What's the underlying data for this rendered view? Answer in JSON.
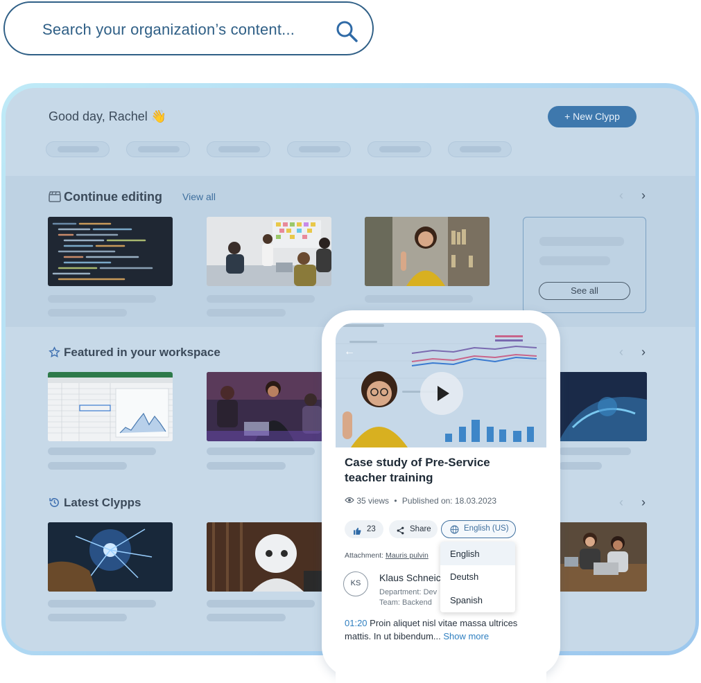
{
  "search": {
    "placeholder": "Search your organization’s content..."
  },
  "header": {
    "greeting": "Good day, Rachel",
    "greeting_emoji": "👋",
    "new_button": "+ New Clypp"
  },
  "sections": {
    "continue_editing": {
      "title": "Continue editing",
      "view_all": "View all",
      "see_all": "See all"
    },
    "featured": {
      "title": "Featured in your workspace"
    },
    "latest": {
      "title": "Latest Clypps"
    }
  },
  "video_card": {
    "title": "Case study of Pre-Service teacher training",
    "views": "35 views",
    "separator": "•",
    "published": "Published on: 18.03.2023",
    "likes": "23",
    "share": "Share",
    "language": "English (US)",
    "language_options": [
      "English",
      "Deutsh",
      "Spanish"
    ],
    "attachment_label": "Attachment:",
    "attachment_name": "Mauris pulvin",
    "author": {
      "initials": "KS",
      "name": "Klaus  Schneic",
      "department": "Department: Dev",
      "team": "Team: Backend"
    },
    "description": {
      "timestamp": "01:20",
      "text": " Proin aliquet nisl vitae massa ultrices mattis. In ut bibendum...",
      "show_more": " Show more"
    }
  },
  "colors": {
    "accent": "#3e78ad",
    "panel": "#c7d9e8",
    "frame_border": "#a9d2f1",
    "link": "#2f7fc0"
  },
  "icons": [
    "search-icon",
    "clapper-icon",
    "star-icon",
    "history-icon",
    "chevron-left-icon",
    "chevron-right-icon",
    "play-icon",
    "back-arrow-icon",
    "eye-icon",
    "thumbs-up-icon",
    "share-icon",
    "globe-icon"
  ]
}
